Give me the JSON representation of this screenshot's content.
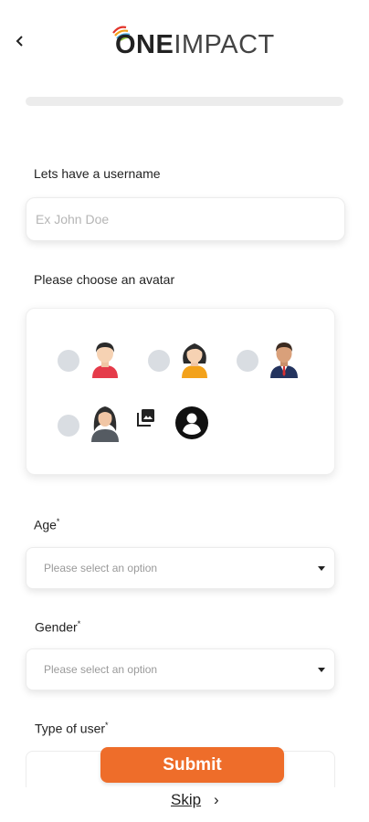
{
  "header": {
    "back_icon": "chevron-left-icon",
    "logo": {
      "part1": "ONE",
      "part2": "IMPACT"
    }
  },
  "progress": {
    "value_percent": 0
  },
  "username": {
    "label": "Lets have a username",
    "placeholder": "Ex John Doe",
    "value": ""
  },
  "avatar": {
    "label": "Please choose an avatar",
    "options": [
      {
        "icon": "man-avatar-icon",
        "selected": false
      },
      {
        "icon": "woman-avatar-icon",
        "selected": false
      },
      {
        "icon": "businessman-avatar-icon",
        "selected": false
      },
      {
        "icon": "hijab-woman-avatar-icon",
        "selected": false
      }
    ],
    "gallery_icon": "photo-gallery-icon",
    "profile_icon": "account-circle-icon"
  },
  "age": {
    "label": "Age",
    "required_mark": "*",
    "placeholder": "Please select an option"
  },
  "gender": {
    "label": "Gender",
    "required_mark": "*",
    "placeholder": "Please select an option"
  },
  "user_type": {
    "label": "Type of user",
    "required_mark": "*"
  },
  "actions": {
    "submit_label": "Submit",
    "skip_label": "Skip",
    "skip_chevron": "›"
  },
  "colors": {
    "accent": "#ee6d2a",
    "radio": "#d9dde2",
    "track": "#ececec"
  }
}
